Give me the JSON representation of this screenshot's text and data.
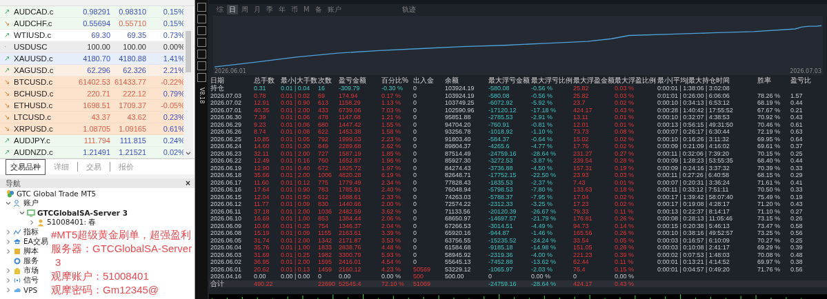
{
  "market_watch": {
    "rows": [
      {
        "arrow": "↗",
        "unchanged": false,
        "falling": false,
        "symbol": "AUDCAD.c",
        "bid": "0.98291",
        "ask": "0.98310",
        "change": "0.15%",
        "bid_down": false,
        "ask_down": false,
        "change_down": false,
        "color": "#eef8ee"
      },
      {
        "arrow": "↘",
        "unchanged": false,
        "falling": true,
        "symbol": "AUDCHF.c",
        "bid": "0.55694",
        "ask": "0.55710",
        "change": "0.15%",
        "bid_down": false,
        "ask_down": true,
        "change_down": false,
        "color": "#eef8ee"
      },
      {
        "arrow": "↗",
        "unchanged": false,
        "falling": false,
        "symbol": "WTIUSD.c",
        "bid": "69.30",
        "ask": "69.35",
        "change": "0.73%",
        "bid_down": false,
        "ask_down": false,
        "change_down": false,
        "color": "#ffffff"
      },
      {
        "arrow": "·",
        "unchanged": true,
        "symbol": "USDUSC",
        "bid": "100.00",
        "ask": "100.00",
        "change": "0.00%",
        "color": "#ececec"
      },
      {
        "arrow": "↗",
        "unchanged": false,
        "falling": false,
        "symbol": "XAUUSD.c",
        "bid": "4180.70",
        "ask": "4180.88",
        "change": "1.41%",
        "bid_down": false,
        "ask_down": false,
        "change_down": false,
        "color": "#e6eefa"
      },
      {
        "arrow": "↗",
        "unchanged": false,
        "falling": false,
        "symbol": "XAGUSD.c",
        "bid": "62.296",
        "ask": "62.326",
        "change": "2.21%",
        "bid_down": false,
        "ask_down": false,
        "change_down": false,
        "color": "#fbeee2"
      },
      {
        "arrow": "↘",
        "unchanged": false,
        "falling": true,
        "symbol": "BTCUSD.c",
        "bid": "61402.53",
        "ask": "61433.77",
        "change": "-0.22%",
        "bid_down": true,
        "ask_down": true,
        "change_down": true,
        "color": "#fde3cc"
      },
      {
        "arrow": "↘",
        "unchanged": false,
        "falling": true,
        "symbol": "BCHUSD.c",
        "bid": "220.71",
        "ask": "222.12",
        "change": "0.79%",
        "bid_down": true,
        "ask_down": true,
        "change_down": false,
        "color": "#fde3cc"
      },
      {
        "arrow": "↘",
        "unchanged": false,
        "falling": true,
        "symbol": "ETHUSD.c",
        "bid": "1698.51",
        "ask": "1709.37",
        "change": "-0.05%",
        "bid_down": true,
        "ask_down": true,
        "change_down": true,
        "color": "#fde3cc"
      },
      {
        "arrow": "↘",
        "unchanged": false,
        "falling": true,
        "symbol": "LTCUSD.c",
        "bid": "43.37",
        "ask": "43.62",
        "change": "0.23%",
        "bid_down": true,
        "ask_down": true,
        "change_down": false,
        "color": "#fde3cc"
      },
      {
        "arrow": "↘",
        "unchanged": false,
        "falling": true,
        "symbol": "XRPUSD.c",
        "bid": "1.08705",
        "ask": "1.09165",
        "change": "0.61%",
        "bid_down": true,
        "ask_down": true,
        "change_down": false,
        "color": "#fde3cc"
      },
      {
        "arrow": "↗",
        "unchanged": false,
        "falling": false,
        "symbol": "AUDJPY.c",
        "bid": "111.794",
        "ask": "111.815",
        "change": "0.24%",
        "bid_down": true,
        "ask_down": false,
        "change_down": false,
        "color": "#eef8ee"
      },
      {
        "arrow": "↗",
        "unchanged": false,
        "falling": false,
        "symbol": "AUDNZD.c",
        "bid": "1.21491",
        "ask": "1.21521",
        "change": "0.02%",
        "bid_down": false,
        "ask_down": false,
        "change_down": false,
        "color": "#eef8ee"
      }
    ],
    "tabs": [
      {
        "label": "交易品种",
        "selected": true
      },
      {
        "label": "详细",
        "selected": false
      },
      {
        "label": "交易",
        "selected": false
      },
      {
        "label": "报价",
        "selected": false
      }
    ]
  },
  "navigator": {
    "title": "导航",
    "close": "×",
    "root": "GTC Global Trade MT5",
    "items": [
      {
        "label": "账户",
        "expanded": true,
        "children": [
          {
            "label": "GTCGlobalSA-Server 3",
            "expanded": true,
            "children": [
              {
                "label": "51008401: 春",
                "expanded": false
              }
            ]
          }
        ]
      },
      {
        "label": "指标",
        "expanded": false
      },
      {
        "label": "EA交易",
        "expanded": false
      },
      {
        "label": "脚本",
        "expanded": false
      },
      {
        "label": "服务"
      },
      {
        "label": "市场",
        "expanded": false
      },
      {
        "label": "信号",
        "expanded": false
      },
      {
        "label": "VPS",
        "expanded": false
      }
    ]
  },
  "overlay_text": [
    "#MT5超级黄金刷单，超强盈利",
    "服务器：GTCGlobalSA-Server",
    "3",
    "观摩账户：51008401",
    "观摩密码：Gm12345@"
  ],
  "report": {
    "version": "V8.18",
    "tabs": [
      {
        "label": "综",
        "selected": false
      },
      {
        "label": "日",
        "selected": true
      },
      {
        "label": "周",
        "selected": false
      },
      {
        "label": "月",
        "selected": false
      },
      {
        "label": "季",
        "selected": false
      },
      {
        "label": "年",
        "selected": false
      },
      {
        "label": "币",
        "selected": false
      },
      {
        "label": "M",
        "selected": false
      },
      {
        "label": "备",
        "selected": false
      },
      {
        "label": "账户",
        "selected": false
      }
    ],
    "trace_label": "轨迹",
    "chart": {
      "start_label": "2026.06.01",
      "end_label": "2026.07.03"
    },
    "columns": [
      "日期",
      "总手数",
      "最小|大手数",
      "次数",
      "盈亏金额",
      "百分比%",
      "出入金",
      "余额",
      "最大浮亏金额",
      "最大浮亏比例",
      "最大浮盈金额",
      "最大浮盈比例",
      "最小|平均|最大持仓时间",
      "胜率",
      "盈亏比"
    ],
    "rows": [
      {
        "kind": "position",
        "negative": true,
        "zero": false,
        "flow_marked": false,
        "date": "持仓",
        "lots": "0.31",
        "lot_range": "0.01 | 0.04",
        "trades": "16",
        "pnl": "-309.79",
        "pct": "-0.30 %",
        "flow": "0",
        "balance": "103924.19",
        "max_dd": "-580.08",
        "max_dd_pct": "-0.56 %",
        "max_fp": "25.82",
        "max_fp_pct": "0.03 %",
        "hold_times": "0:00:01 | 1:38:06 | 3:02:08"
      },
      {
        "kind": "day",
        "negative": false,
        "zero": false,
        "flow_marked": false,
        "date": "2026.07.03",
        "lots": "0.78",
        "lot_range": "0.01 | 0.02",
        "trades": "69",
        "pnl": "174.94",
        "pct": "0.17 %",
        "flow": "0",
        "balance": "103924.19",
        "max_dd": "-580.08",
        "max_dd_pct": "-0.56 %",
        "max_fp": "25.82",
        "max_fp_pct": "0.03 %",
        "hold_times": "0:01:01 | 0:26:00 | 6:06:06",
        "win_rate": "78.26 %",
        "pl_ratio": "1.57"
      },
      {
        "kind": "day",
        "negative": false,
        "zero": false,
        "flow_marked": false,
        "date": "2026.07.02",
        "lots": "12.91",
        "lot_range": "0.01 | 0.90",
        "trades": "613",
        "pnl": "1158.29",
        "pct": "1.13 %",
        "flow": "0",
        "balance": "103749.25",
        "max_dd": "-6072.92",
        "max_dd_pct": "-5.92 %",
        "max_fp": "23.7",
        "max_fp_pct": "0.02 %",
        "hold_times": "0:00:10 | 0:34:13 | 6:53:12",
        "win_rate": "68.19 %",
        "pl_ratio": "0.44"
      },
      {
        "kind": "day",
        "negative": false,
        "zero": false,
        "flow_marked": false,
        "date": "2026.07.01",
        "lots": "40.35",
        "lot_range": "0.01 | 2.00",
        "trades": "433",
        "pnl": "6739.06",
        "pct": "7.03 %",
        "flow": "0",
        "balance": "102590.96",
        "max_dd": "-17120.12",
        "max_dd_pct": "-17.18 %",
        "max_fp": "424.17",
        "max_fp_pct": "0.43 %",
        "hold_times": "0:00:28 | 1:40:42 | 17:55:52",
        "win_rate": "67.67 %",
        "pl_ratio": "0.21"
      },
      {
        "kind": "day",
        "negative": false,
        "zero": false,
        "flow_marked": false,
        "date": "2026.06.30",
        "lots": "7.39",
        "lot_range": "0.01 | 0.06",
        "trades": "478",
        "pnl": "1147.68",
        "pct": "1.21 %",
        "flow": "0",
        "balance": "95851.88",
        "max_dd": "-2785.53",
        "max_dd_pct": "-2.91 %",
        "max_fp": "13.11",
        "max_fp_pct": "0.01 %",
        "hold_times": "0:00:10 | 0:32:07 | 4:38:53",
        "win_rate": "70.92 %",
        "pl_ratio": "0.43"
      },
      {
        "kind": "day",
        "negative": false,
        "zero": false,
        "flow_marked": false,
        "date": "2026.06.29",
        "lots": "9.23",
        "lot_range": "0.01 | 0.06",
        "trades": "680",
        "pnl": "1447.42",
        "pct": "1.55 %",
        "flow": "0",
        "balance": "94704.20",
        "max_dd": "-760.91",
        "max_dd_pct": "-0.81 %",
        "max_fp": "12.01",
        "max_fp_pct": "0.01 %",
        "hold_times": "0:00:13 | 0:56:15 | 49:31:50",
        "win_rate": "70.46 %",
        "pl_ratio": "0.61"
      },
      {
        "kind": "day",
        "negative": false,
        "zero": false,
        "flow_marked": false,
        "date": "2026.06.26",
        "lots": "8.74",
        "lot_range": "0.01 | 0.08",
        "trades": "622",
        "pnl": "1453.38",
        "pct": "1.58 %",
        "flow": "0",
        "balance": "93256.78",
        "max_dd": "-1018.92",
        "max_dd_pct": "-1.10 %",
        "max_fp": "73.73",
        "max_fp_pct": "0.08 %",
        "hold_times": "0:00:07 | 0:26:17 | 6:30:44",
        "win_rate": "72.19 %",
        "pl_ratio": "0.63"
      },
      {
        "kind": "day",
        "negative": false,
        "zero": false,
        "flow_marked": false,
        "date": "2026.06.25",
        "lots": "10.85",
        "lot_range": "0.01 | 0.05",
        "trades": "792",
        "pnl": "1999.03",
        "pct": "2.23 %",
        "flow": "0",
        "balance": "91803.40",
        "max_dd": "-584.37",
        "max_dd_pct": "-0.64 %",
        "max_fp": "15.02",
        "max_fp_pct": "0.02 %",
        "hold_times": "0:00:10 | 0:16:26 | 3:11:32",
        "win_rate": "69.95 %",
        "pl_ratio": "0.64"
      },
      {
        "kind": "day",
        "negative": false,
        "zero": false,
        "flow_marked": false,
        "date": "2026.06.24",
        "lots": "14.60",
        "lot_range": "0.01 | 0.20",
        "trades": "849",
        "pnl": "2289.68",
        "pct": "2.62 %",
        "flow": "0",
        "balance": "89804.37",
        "max_dd": "-4265.6",
        "max_dd_pct": "-4.77 %",
        "max_fp": "17.76",
        "max_fp_pct": "0.02 %",
        "hold_times": "0:00:09 | 0:21:09 | 4:16:02",
        "win_rate": "69.61 %",
        "pl_ratio": "0.37"
      },
      {
        "kind": "day",
        "negative": false,
        "zero": false,
        "flow_marked": false,
        "date": "2026.06.23",
        "lots": "32.11",
        "lot_range": "0.01 | 2.00",
        "trades": "727",
        "pnl": "1587.19",
        "pct": "1.85 %",
        "flow": "0",
        "balance": "87514.49",
        "max_dd": "-24759.16",
        "max_dd_pct": "-28.64 %",
        "max_fp": "231.27",
        "max_fp_pct": "0.27 %",
        "hold_times": "0:00:11 | 0:32:06 | 7:39:20",
        "win_rate": "70.15 %",
        "pl_ratio": "0.25"
      },
      {
        "kind": "day",
        "negative": false,
        "zero": false,
        "flow_marked": false,
        "date": "2026.06.22",
        "lots": "12.49",
        "lot_range": "0.01 | 0.16",
        "trades": "760",
        "pnl": "1652.87",
        "pct": "1.96 %",
        "flow": "0",
        "balance": "85927.30",
        "max_dd": "-3272.53",
        "max_dd_pct": "-3.87 %",
        "max_fp": "239.54",
        "max_fp_pct": "0.28 %",
        "hold_times": "0:00:09 | 1:28:23 | 53:55:35",
        "win_rate": "68.40 %",
        "pl_ratio": "0.44"
      },
      {
        "kind": "day",
        "negative": false,
        "zero": false,
        "flow_marked": false,
        "date": "2026.06.19",
        "lots": "12.90",
        "lot_range": "0.01 | 0.40",
        "trades": "672",
        "pnl": "1825.72",
        "pct": "1.97 %",
        "flow": "0",
        "balance": "84274.43",
        "max_dd": "-3736.88",
        "max_dd_pct": "-4.50 %",
        "max_fp": "157.31",
        "max_fp_pct": "0.19 %",
        "hold_times": "0:00:09 | 0:24:16 | 3:37:32",
        "win_rate": "70.39 %",
        "pl_ratio": "0.33"
      },
      {
        "kind": "day",
        "negative": false,
        "zero": false,
        "flow_marked": false,
        "date": "2026.06.18",
        "lots": "35.66",
        "lot_range": "0.01 | 2.00",
        "trades": "1006",
        "pnl": "4820.28",
        "pct": "6.19 %",
        "flow": "0",
        "balance": "82648.71",
        "max_dd": "-17752.15",
        "max_dd_pct": "-22.50 %",
        "max_fp": "23.93",
        "max_fp_pct": "0.03 %",
        "hold_times": "0:00:11 | 0:27:26 | 6:40:58",
        "win_rate": "68.15 %",
        "pl_ratio": "0.29"
      },
      {
        "kind": "day",
        "negative": false,
        "zero": false,
        "flow_marked": false,
        "date": "2026.06.17",
        "lots": "11.60",
        "lot_range": "0.01 | 0.12",
        "trades": "775",
        "pnl": "1779.49",
        "pct": "2.34 %",
        "flow": "0",
        "balance": "77828.43",
        "max_dd": "-1835.53",
        "max_dd_pct": "-2.37 %",
        "max_fp": "7.43",
        "max_fp_pct": "0.01 %",
        "hold_times": "0:00:07 | 0:20:31 | 3:36:24",
        "win_rate": "71.61 %",
        "pl_ratio": "0.41"
      },
      {
        "kind": "day",
        "negative": false,
        "zero": false,
        "flow_marked": false,
        "date": "2026.06.16",
        "lots": "17.64",
        "lot_range": "0.01 | 0.90",
        "trades": "783",
        "pnl": "1785.91",
        "pct": "2.40 %",
        "flow": "0",
        "balance": "76048.94",
        "max_dd": "-5798.53",
        "max_dd_pct": "-7.80 %",
        "max_fp": "133.63",
        "max_fp_pct": "0.18 %",
        "hold_times": "0:00:11 | 0:33:12 | 7:51:11",
        "win_rate": "70.50 %",
        "pl_ratio": "0.33"
      },
      {
        "kind": "day",
        "negative": false,
        "zero": false,
        "flow_marked": false,
        "date": "2026.06.15",
        "lots": "12.04",
        "lot_range": "0.01 | 0.50",
        "trades": "612",
        "pnl": "1688.61",
        "pct": "2.33 %",
        "flow": "0",
        "balance": "74263.03",
        "max_dd": "-5788.37",
        "max_dd_pct": "-7.95 %",
        "max_fp": "17.04",
        "max_fp_pct": "0.02 %",
        "hold_times": "0:00:17 | 1:39:42 | 58:07:40",
        "win_rate": "75.49 %",
        "pl_ratio": "0.19"
      },
      {
        "kind": "day",
        "negative": false,
        "zero": false,
        "flow_marked": false,
        "date": "2026.06.12",
        "lots": "11.77",
        "lot_range": "0.01 | 0.09",
        "trades": "830",
        "pnl": "1440.66",
        "pct": "2.00 %",
        "flow": "0",
        "balance": "72574.22",
        "max_dd": "-2312.33",
        "max_dd_pct": "-3.25 %",
        "max_fp": "17.23",
        "max_fp_pct": "0.02 %",
        "hold_times": "0:00:17 | 0:19:08 | 4:28:17",
        "win_rate": "71.20 %",
        "pl_ratio": "0.43"
      },
      {
        "kind": "day",
        "negative": false,
        "zero": false,
        "flow_marked": false,
        "date": "2026.06.11",
        "lots": "37.18",
        "lot_range": "0.01 | 2.00",
        "trades": "1036",
        "pnl": "2482.59",
        "pct": "3.62 %",
        "flow": "0",
        "balance": "71133.56",
        "max_dd": "-20120.39",
        "max_dd_pct": "-26.67 %",
        "max_fp": "79.33",
        "max_fp_pct": "0.11 %",
        "hold_times": "0:00:13 | 0:22:37 | 8:14:17",
        "win_rate": "71.10 %",
        "pl_ratio": "0.27"
      },
      {
        "kind": "day",
        "negative": false,
        "zero": false,
        "flow_marked": false,
        "date": "2026.06.10",
        "lots": "16.69",
        "lot_range": "0.01 | 1.00",
        "trades": "853",
        "pnl": "1384.44",
        "pct": "2.06 %",
        "flow": "0",
        "balance": "68650.97",
        "max_dd": "-14697.57",
        "max_dd_pct": "-21.79 %",
        "max_fp": "176.81",
        "max_fp_pct": "0.26 %",
        "hold_times": "0:00:08 | 0:28:13 | 11:05:46",
        "win_rate": "73.15 %",
        "pl_ratio": "0.26"
      },
      {
        "kind": "day",
        "negative": false,
        "zero": false,
        "flow_marked": false,
        "date": "2026.06.09",
        "lots": "10.66",
        "lot_range": "0.01 | 0.25",
        "trades": "754",
        "pnl": "1346.37",
        "pct": "2.04 %",
        "flow": "0",
        "balance": "67266.53",
        "max_dd": "-3014.51",
        "max_dd_pct": "-4.49 %",
        "max_fp": "94.73",
        "max_fp_pct": "0.14 %",
        "hold_times": "0:00:15 | 0:20:38 | 5:46:13",
        "win_rate": "73.47 %",
        "pl_ratio": "0.58"
      },
      {
        "kind": "day",
        "negative": false,
        "zero": false,
        "flow_marked": false,
        "date": "2026.06.08",
        "lots": "15.19",
        "lot_range": "0.01 | 0.09",
        "trades": "1155",
        "pnl": "2163.61",
        "pct": "3.39 %",
        "flow": "0",
        "balance": "65920.16",
        "max_dd": "-944.87",
        "max_dd_pct": "-1.46 %",
        "max_fp": "165.56",
        "max_fp_pct": "0.26 %",
        "hold_times": "0:00:10 | 0:38:16 | 49:52:57",
        "win_rate": "73.25 %",
        "pl_ratio": "0.56"
      },
      {
        "kind": "day",
        "negative": false,
        "zero": false,
        "flow_marked": false,
        "date": "2026.06.05",
        "lots": "31.74",
        "lot_range": "0.01 | 2.00",
        "trades": "1342",
        "pnl": "2171.87",
        "pct": "3.53 %",
        "flow": "0",
        "balance": "63756.55",
        "max_dd": "-15235.52",
        "max_dd_pct": "-24.24 %",
        "max_fp": "33.54",
        "max_fp_pct": "0.05 %",
        "hold_times": "0:00:03 | 0:16:57 | 6:10:09",
        "win_rate": "70.27 %",
        "pl_ratio": "0.25"
      },
      {
        "kind": "day",
        "negative": false,
        "zero": false,
        "flow_marked": false,
        "date": "2026.06.04",
        "lots": "35.76",
        "lot_range": "0.01 | 1.00",
        "trades": "1833",
        "pnl": "2838.76",
        "pct": "4.48 %",
        "flow": "0",
        "balance": "61584.68",
        "max_dd": "-9185.18",
        "max_dd_pct": "-14.98 %",
        "max_fp": "151.05",
        "max_fp_pct": "0.26 %",
        "hold_times": "0:00:03 | 0:10:08 | 2:41:17",
        "win_rate": "69.29 %",
        "pl_ratio": "0.39"
      },
      {
        "kind": "day",
        "negative": false,
        "zero": false,
        "flow_marked": false,
        "date": "2026.06.03",
        "lots": "31.69",
        "lot_range": "0.01 | 0.25",
        "trades": "1982",
        "pnl": "3300.79",
        "pct": "5.93 %",
        "flow": "0",
        "balance": "58945.92",
        "max_dd": "-2319.36",
        "max_dd_pct": "-4.00 %",
        "max_fp": "221.23",
        "max_fp_pct": "0.39 %",
        "hold_times": "0:00:02 | 0:07:53 | 1:48:03",
        "win_rate": "70.08 %",
        "pl_ratio": "0.48"
      },
      {
        "kind": "day",
        "negative": false,
        "zero": false,
        "flow_marked": false,
        "date": "2026.06.02",
        "lots": "36.95",
        "lot_range": "0.01 | 2.00",
        "trades": "1595",
        "pnl": "2416.01",
        "pct": "4.54 %",
        "flow": "0",
        "balance": "55645.13",
        "max_dd": "-7452.88",
        "max_dd_pct": "-13.62 %",
        "max_fp": "62.44",
        "max_fp_pct": "0.11 %",
        "hold_times": "0:00:01 | 0:13:21 | 4:14:52",
        "win_rate": "69.97 %",
        "pl_ratio": "0.38"
      },
      {
        "kind": "day",
        "negative": false,
        "zero": false,
        "flow_marked": true,
        "date": "2026.06.01",
        "lots": "20.62",
        "lot_range": "0.01 | 0.13",
        "trades": "1459",
        "pnl": "2160.12",
        "pct": "4.23 %",
        "flow": "50569",
        "balance": "53229.12",
        "max_dd": "-1065.97",
        "max_dd_pct": "-2.03 %",
        "max_fp": "76.4",
        "max_fp_pct": "0.15 %",
        "hold_times": "0:00:01 | 0:04:57 | 0:49:20",
        "win_rate": "71.76 %",
        "pl_ratio": "0.56"
      },
      {
        "kind": "day",
        "zero": true,
        "flow_marked": true,
        "date": "2026.04.16",
        "lots": "0.00",
        "lot_range": "0.00 | 0.00",
        "trades": "0",
        "pnl": "0.00",
        "pct": "0.00 %",
        "flow": "500",
        "balance": "500.00",
        "max_dd": "0",
        "max_dd_pct": "0.00 %",
        "max_fp": "0",
        "max_fp_pct": "0.00 %"
      },
      {
        "kind": "total",
        "negative": false,
        "zero": false,
        "flow_marked": true,
        "date": "合计",
        "lots": "490.22",
        "trades": "22690",
        "pnl": "52545.4",
        "pct": "72.10 %",
        "flow": "51069",
        "max_dd": "-24759.16",
        "max_dd_pct": "-28.64 %",
        "max_fp": "424.17",
        "max_fp_pct": "0.43 %"
      }
    ]
  }
}
